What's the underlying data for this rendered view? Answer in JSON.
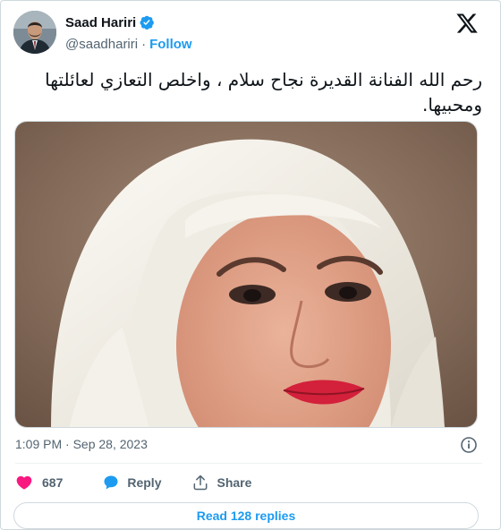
{
  "author": {
    "name": "Saad Hariri",
    "handle": "@saadhariri",
    "follow_label": "Follow"
  },
  "tweet": {
    "text": "رحم الله الفنانة القديرة نجاح سلام ، واخلص التعازي لعائلتها ومحبيها.",
    "timestamp": "1:09 PM · Sep 28, 2023"
  },
  "actions": {
    "like_count": "687",
    "reply_label": "Reply",
    "share_label": "Share"
  },
  "read_replies_label": "Read 128 replies",
  "colors": {
    "accent": "#1d9bf0",
    "like": "#f91880",
    "verified": "#1d9bf0",
    "muted": "#536471"
  },
  "icons": [
    "verified-badge-icon",
    "x-logo-icon",
    "info-icon",
    "heart-icon",
    "reply-bubble-icon",
    "share-arrow-icon"
  ]
}
